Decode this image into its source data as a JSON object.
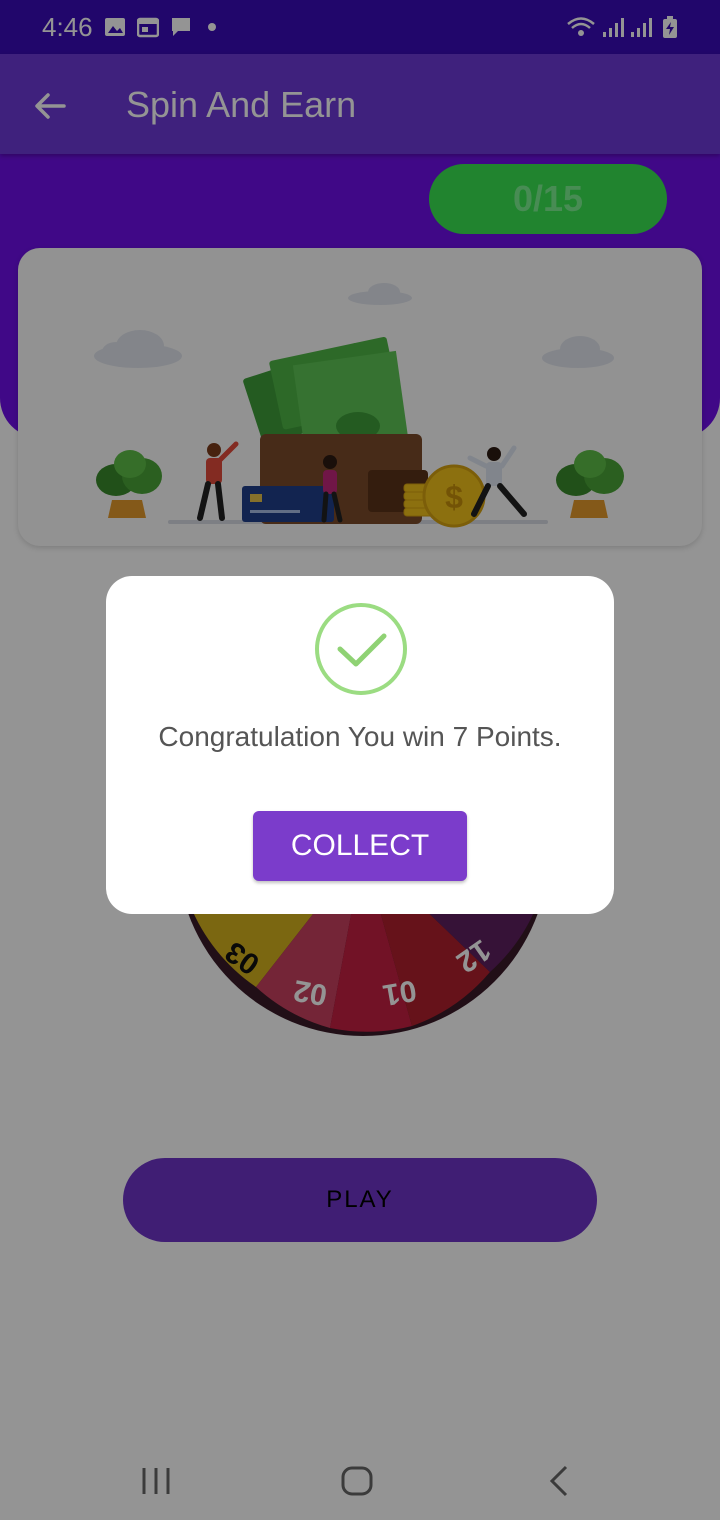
{
  "status_bar": {
    "time": "4:46",
    "icons": [
      "image-icon",
      "calendar-icon",
      "message-icon",
      "dot-icon",
      "wifi-icon",
      "signal-icon",
      "signal-icon",
      "battery-charging-icon"
    ]
  },
  "app_bar": {
    "title": "Spin And Earn",
    "back_icon": "arrow-left-icon"
  },
  "counter": "0/15",
  "wheel": {
    "visible_segments": [
      "03",
      "02",
      "01",
      "12"
    ],
    "segment_colors": [
      "#d4b21e",
      "#c9415f",
      "#c41f43",
      "#b0202e",
      "#5e1f60"
    ]
  },
  "play_label": "PLAY",
  "dialog": {
    "icon": "check-circle-icon",
    "message": "Congratulation You win 7 Points.",
    "collect_label": "COLLECT"
  },
  "nav_bar": {
    "icons": [
      "recent-apps-icon",
      "home-icon",
      "back-icon"
    ]
  },
  "colors": {
    "primary": "#6e0fe8",
    "accent_green": "#39e352",
    "button_purple": "#7b3ccb",
    "check_green": "#9bdc82"
  }
}
